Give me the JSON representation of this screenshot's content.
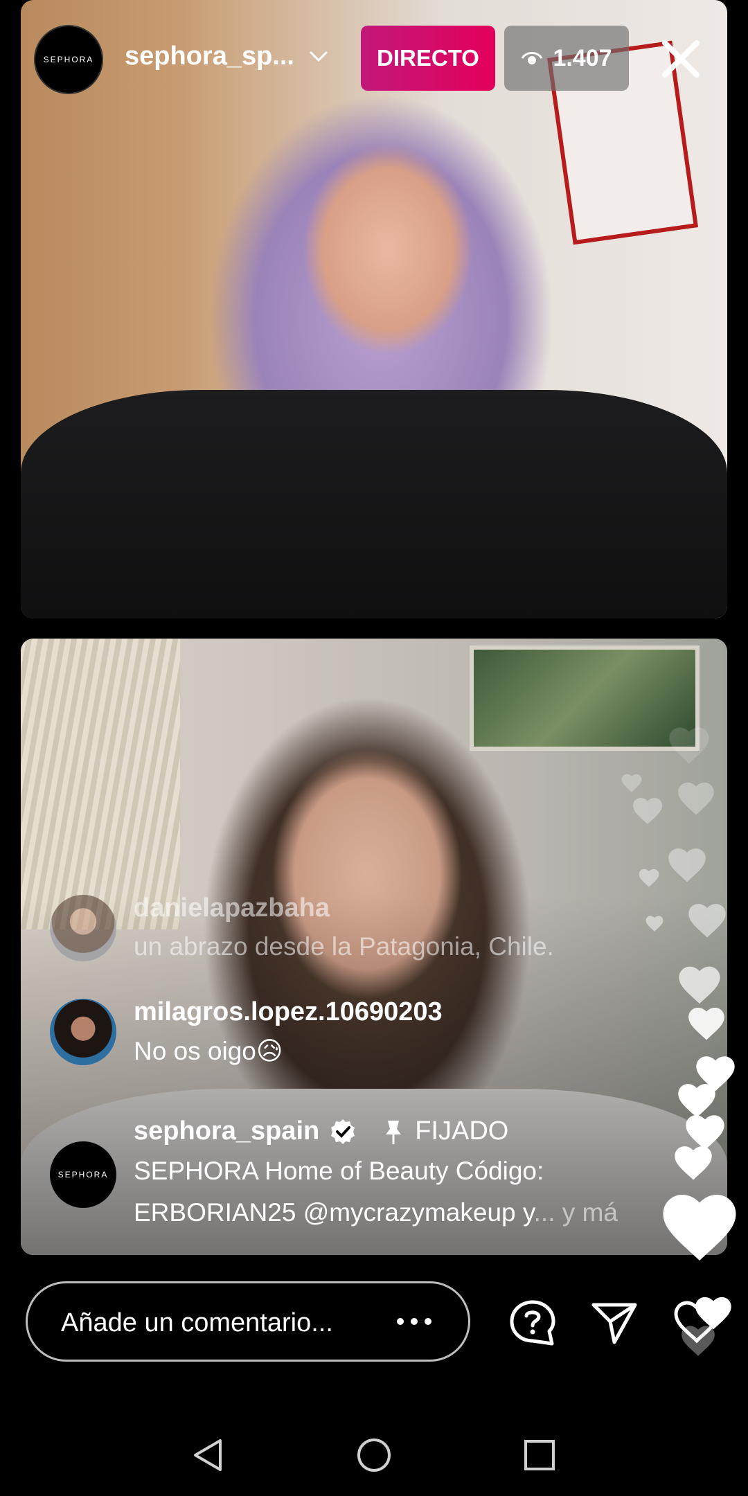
{
  "header": {
    "username": "sephora_sp...",
    "logo_text": "SEPHORA",
    "live_label": "DIRECTO",
    "viewer_count": "1.407"
  },
  "comments": [
    {
      "username": "danielapazbaha",
      "text": "un abrazo desde la Patagonia, Chile."
    },
    {
      "username": "milagros.lopez.10690203",
      "text": "No os oigo😥"
    }
  ],
  "pinned": {
    "username": "sephora_spain",
    "pinned_label": "FIJADO",
    "logo_text": "SEPHORA",
    "line1": "SEPHORA Home of Beauty Código:",
    "line2": "ERBORIAN25 @mycrazymakeup y",
    "more": "... y má"
  },
  "comment_bar": {
    "placeholder": "Añade un comentario..."
  },
  "icons": {
    "chevron": "chevron-down-icon",
    "eye": "eye-icon",
    "close": "close-icon",
    "verified": "verified-icon",
    "pin": "pin-icon",
    "more": "more-dots-icon",
    "question": "question-bubble-icon",
    "send": "send-icon",
    "like": "heart-icon",
    "nav_back": "back-triangle-icon",
    "nav_home": "home-circle-icon",
    "nav_recents": "recents-square-icon"
  },
  "colors": {
    "live_badge": "#e3005a",
    "background": "#000000"
  }
}
